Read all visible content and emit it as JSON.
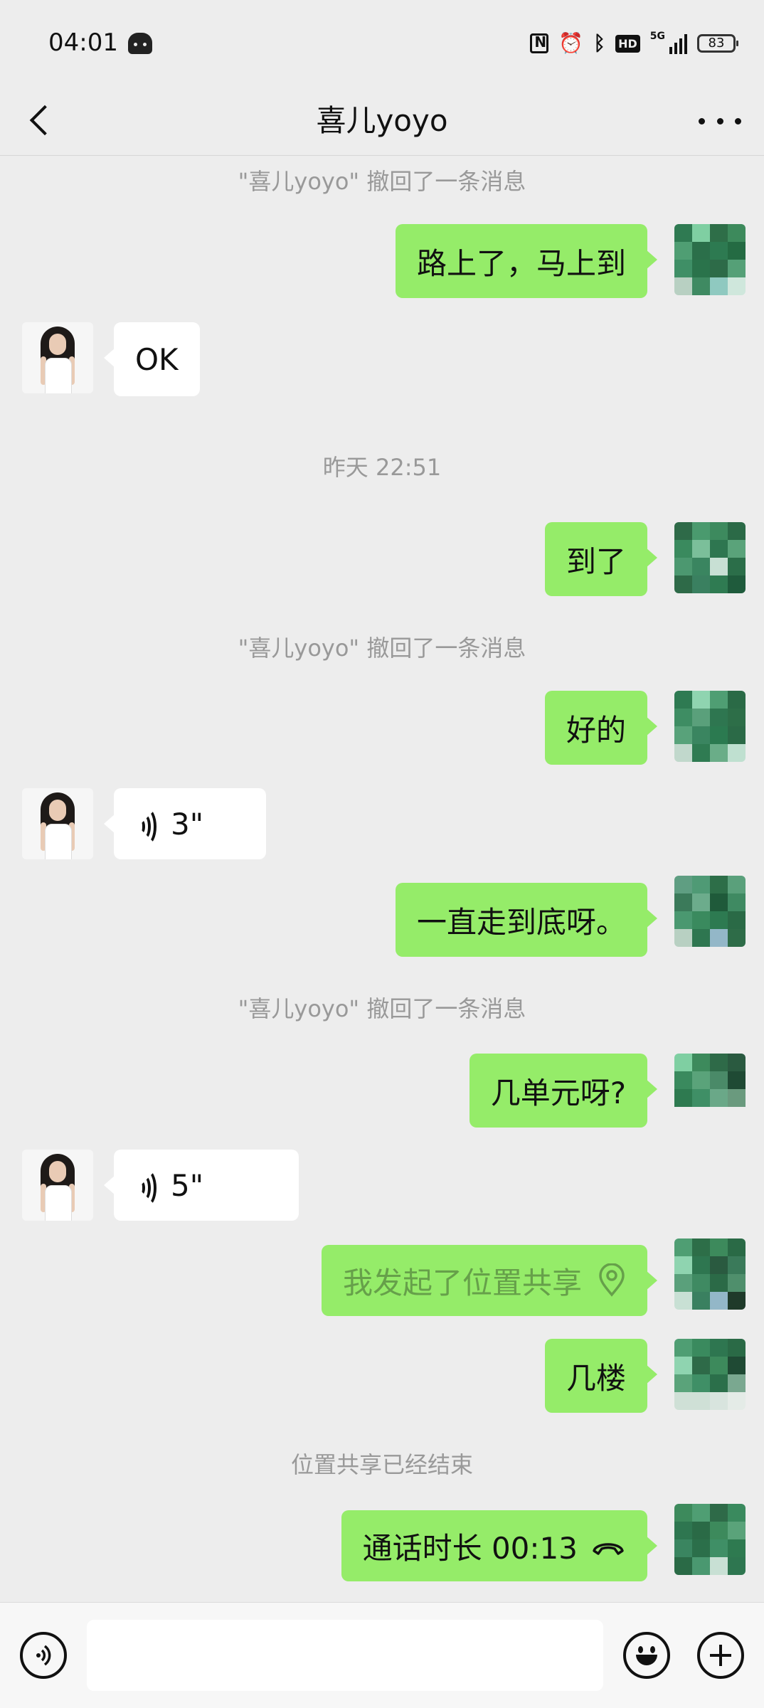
{
  "status_bar": {
    "time": "04:01",
    "network": "5G",
    "hd": "HD",
    "battery": "83"
  },
  "nav": {
    "title": "喜儿yoyo"
  },
  "messages": {
    "sys1": "\"喜儿yoyo\" 撤回了一条消息",
    "m1": "路上了，马上到",
    "m2": "OK",
    "time1": "昨天 22:51",
    "m3": "到了",
    "sys2": "\"喜儿yoyo\" 撤回了一条消息",
    "m4": "好的",
    "voice1": "3\"",
    "m5": "一直走到底呀。",
    "sys3": "\"喜儿yoyo\" 撤回了一条消息",
    "m6": "几单元呀?",
    "voice2": "5\"",
    "m7": "我发起了位置共享",
    "m8": "几楼",
    "sys4": "位置共享已经结束",
    "m9": "通话时长 00:13"
  },
  "input": {
    "value": "",
    "placeholder": ""
  },
  "colors": {
    "my_bubble": "#95ec69",
    "other_bubble": "#ffffff",
    "background": "#ededed",
    "system_text": "#999999"
  },
  "icons": [
    "back-icon",
    "more-icon",
    "voice-wave-icon",
    "location-pin-icon",
    "phone-icon",
    "voice-input-icon",
    "emoji-icon",
    "plus-icon"
  ]
}
